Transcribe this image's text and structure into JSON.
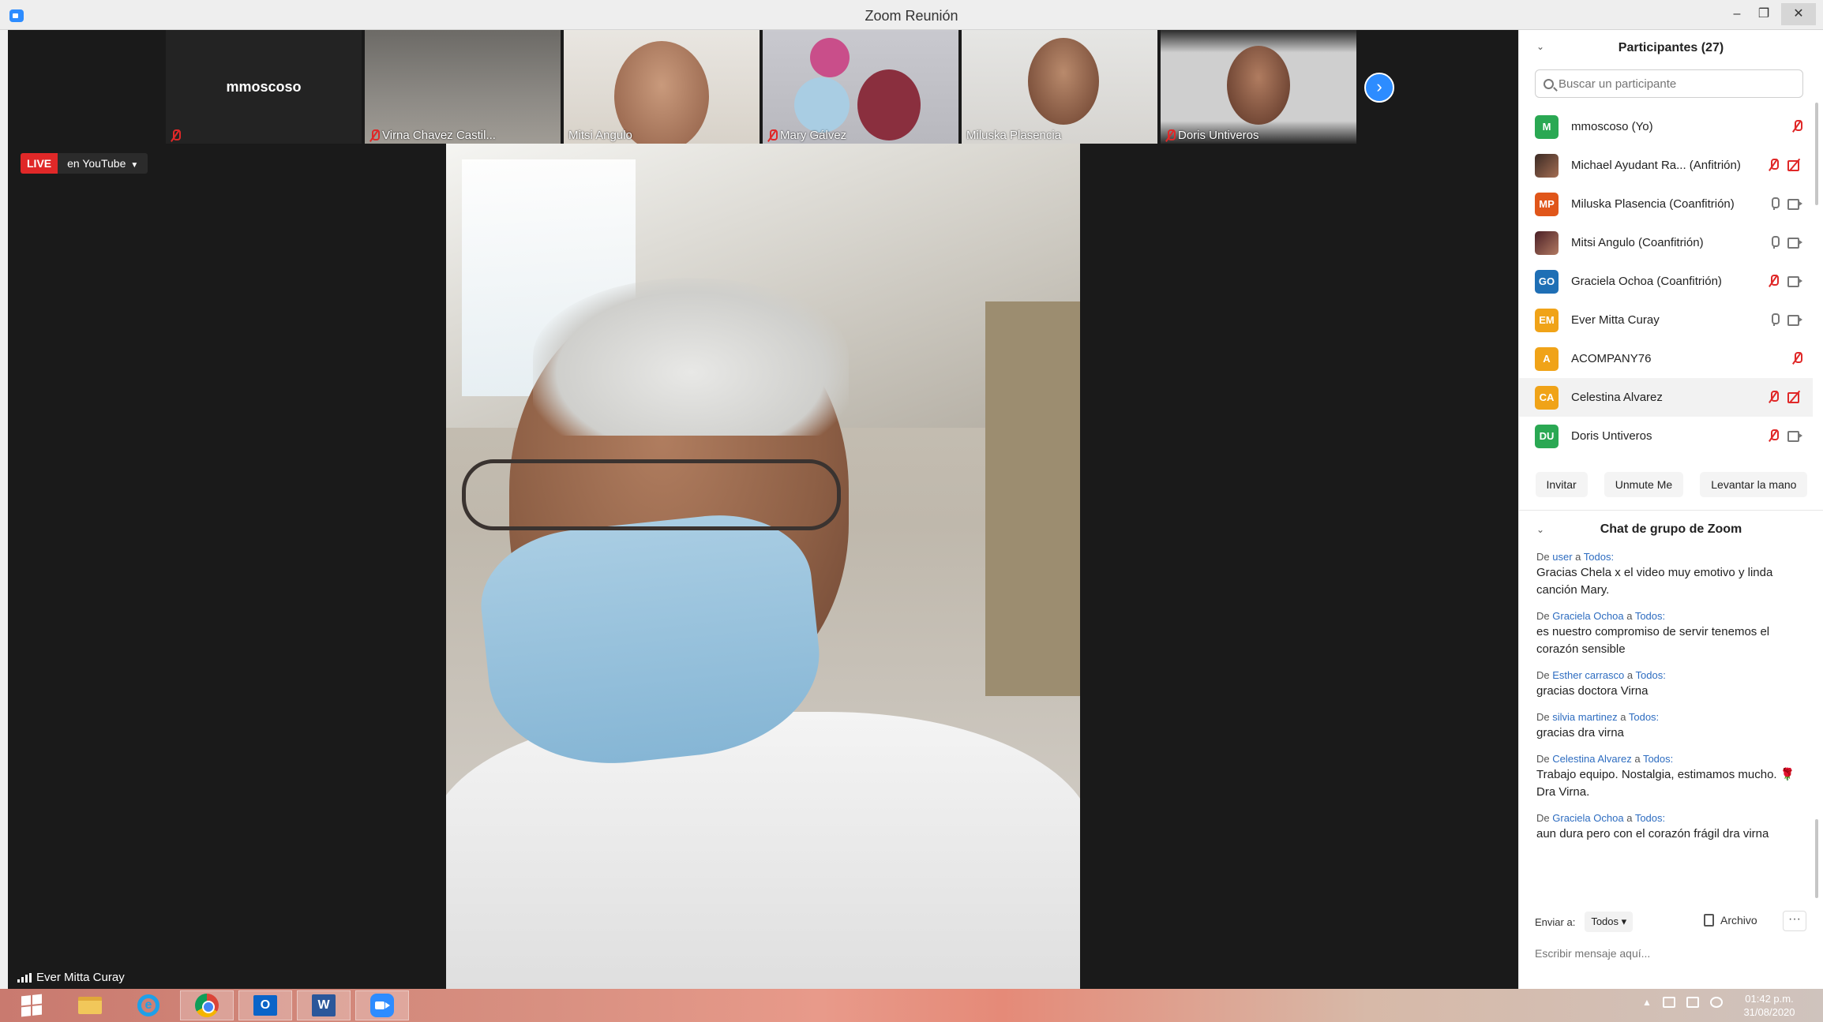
{
  "window": {
    "title": "Zoom Reunión",
    "minimize": "–",
    "maximize": "❐",
    "close": "✕"
  },
  "thumbnails": [
    {
      "name": "mmoscoso",
      "muted": true
    },
    {
      "name": "Virna Chavez Castil...",
      "muted": true
    },
    {
      "name": "Mitsi Angulo",
      "muted": false
    },
    {
      "name": "Mary Gálvez",
      "muted": true
    },
    {
      "name": "Miluska Plasencia",
      "muted": false
    },
    {
      "name": "Doris Untiveros",
      "muted": true
    }
  ],
  "next_page_icon": "›",
  "live": {
    "tag": "LIVE",
    "destination": "en YouTube",
    "caret": "▼"
  },
  "active_speaker": {
    "name": "Ever Mitta Curay"
  },
  "participants_panel": {
    "title": "Participantes (27)",
    "collapse_icon": "⌄",
    "search_placeholder": "Buscar un participante",
    "participants": [
      {
        "initials": "M",
        "color": "#2aa853",
        "name": "mmoscoso (Yo)",
        "mic": "off",
        "cam": "none"
      },
      {
        "initials": "",
        "color": "photo",
        "name": "Michael Ayudant Ra...  (Anfitrión)",
        "mic": "off",
        "cam": "off"
      },
      {
        "initials": "MP",
        "color": "#e0561a",
        "name": "Miluska Plasencia (Coanfitrión)",
        "mic": "on",
        "cam": "on"
      },
      {
        "initials": "",
        "color": "photo",
        "name": "Mitsi Angulo (Coanfitrión)",
        "mic": "on",
        "cam": "on"
      },
      {
        "initials": "GO",
        "color": "#1f6fb5",
        "name": "Graciela Ochoa (Coanfitrión)",
        "mic": "off",
        "cam": "on"
      },
      {
        "initials": "EM",
        "color": "#f0a318",
        "name": "Ever Mitta Curay",
        "mic": "on",
        "cam": "on"
      },
      {
        "initials": "A",
        "color": "#f0a318",
        "name": "ACOMPANY76",
        "mic": "off",
        "cam": "none"
      },
      {
        "initials": "CA",
        "color": "#f0a318",
        "name": "Celestina Alvarez",
        "mic": "off",
        "cam": "off"
      },
      {
        "initials": "DU",
        "color": "#2aa853",
        "name": "Doris Untiveros",
        "mic": "off",
        "cam": "on"
      }
    ],
    "buttons": {
      "invite": "Invitar",
      "unmute": "Unmute Me",
      "raise_hand": "Levantar la mano"
    }
  },
  "chat": {
    "title": "Chat de grupo de Zoom",
    "collapse_icon": "⌄",
    "messages": [
      {
        "de": "De",
        "sender": "user",
        "a": "a",
        "to": "Todos:",
        "text": "Gracias Chela x el video muy emotivo y linda canción Mary."
      },
      {
        "de": "De",
        "sender": "Graciela Ochoa",
        "a": "a",
        "to": "Todos:",
        "text": "es nuestro compromiso de servir tenemos el corazón sensible"
      },
      {
        "de": "De",
        "sender": "Esther carrasco",
        "a": "a",
        "to": "Todos:",
        "text": "gracias doctora Virna"
      },
      {
        "de": "De",
        "sender": "silvia martinez",
        "a": "a",
        "to": "Todos:",
        "text": "gracias dra virna"
      },
      {
        "de": "De",
        "sender": "Celestina Alvarez",
        "a": "a",
        "to": "Todos:",
        "text": "Trabajo equipo. Nostalgia, estimamos mucho. 🌹 Dra Virna."
      },
      {
        "de": "De",
        "sender": "Graciela Ochoa",
        "a": "a",
        "to": "Todos:",
        "text": "aun dura pero con el corazón frágil dra virna"
      }
    ],
    "send_to_label": "Enviar a:",
    "send_to_value": "Todos ▾",
    "file_label": "Archivo",
    "more": "···",
    "input_placeholder": "Escribir mensaje aquí..."
  },
  "taskbar": {
    "apps": [
      "start",
      "file-explorer",
      "internet-explorer",
      "chrome",
      "outlook",
      "word",
      "zoom"
    ],
    "tray_caret": "▲",
    "time": "01:42 p.m.",
    "date": "31/08/2020"
  }
}
